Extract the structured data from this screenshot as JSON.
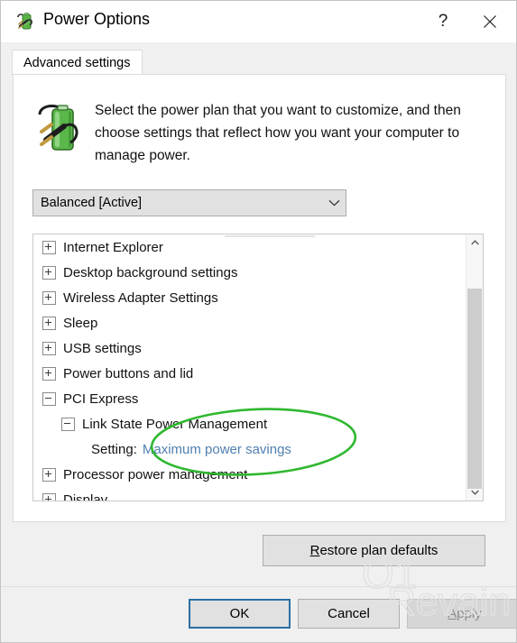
{
  "window": {
    "title": "Power Options",
    "icon": "power-plug-battery-icon",
    "help_label": "?",
    "close_label": "✕"
  },
  "tabs": [
    {
      "label": "Advanced settings",
      "selected": true
    }
  ],
  "description": {
    "icon": "battery-plug-icon",
    "text": "Select the power plan that you want to customize, and then choose settings that reflect how you want your computer to manage power."
  },
  "plan_select": {
    "value": "Balanced [Active]",
    "chevron": "⌄",
    "options": [
      "Balanced [Active]"
    ]
  },
  "tree": {
    "rows": [
      {
        "label": "Internet Explorer",
        "level": 0,
        "state": "collapsed"
      },
      {
        "label": "Desktop background settings",
        "level": 0,
        "state": "collapsed"
      },
      {
        "label": "Wireless Adapter Settings",
        "level": 0,
        "state": "collapsed"
      },
      {
        "label": "Sleep",
        "level": 0,
        "state": "collapsed"
      },
      {
        "label": "USB settings",
        "level": 0,
        "state": "collapsed"
      },
      {
        "label": "Power buttons and lid",
        "level": 0,
        "state": "collapsed"
      },
      {
        "label": "PCI Express",
        "level": 0,
        "state": "expanded"
      },
      {
        "label": "Link State Power Management",
        "level": 1,
        "state": "expanded"
      },
      {
        "label": "Setting:",
        "value": "Maximum power savings",
        "level": 2,
        "state": "leaf"
      },
      {
        "label": "Processor power management",
        "level": 0,
        "state": "collapsed"
      },
      {
        "label": "Display",
        "level": 0,
        "state": "collapsed"
      }
    ]
  },
  "scrollbar": {
    "up_arrow": "∧",
    "down_arrow": "∨"
  },
  "restore_button": {
    "mnemonic": "R",
    "rest": "estore plan defaults"
  },
  "buttons": {
    "ok": "OK",
    "cancel": "Cancel",
    "apply_mnemonic": "A",
    "apply_rest": "pply",
    "apply_disabled": true
  },
  "annotations": {
    "ellipse_color": "#2fb82f",
    "watermark_text": "Revain"
  },
  "colors": {
    "dialog_background": "#f0f0f0",
    "content_background": "#ffffff",
    "link": "#4f7faf",
    "focus_border": "#2a6fa0",
    "disabled_text": "#8c8c8c"
  }
}
